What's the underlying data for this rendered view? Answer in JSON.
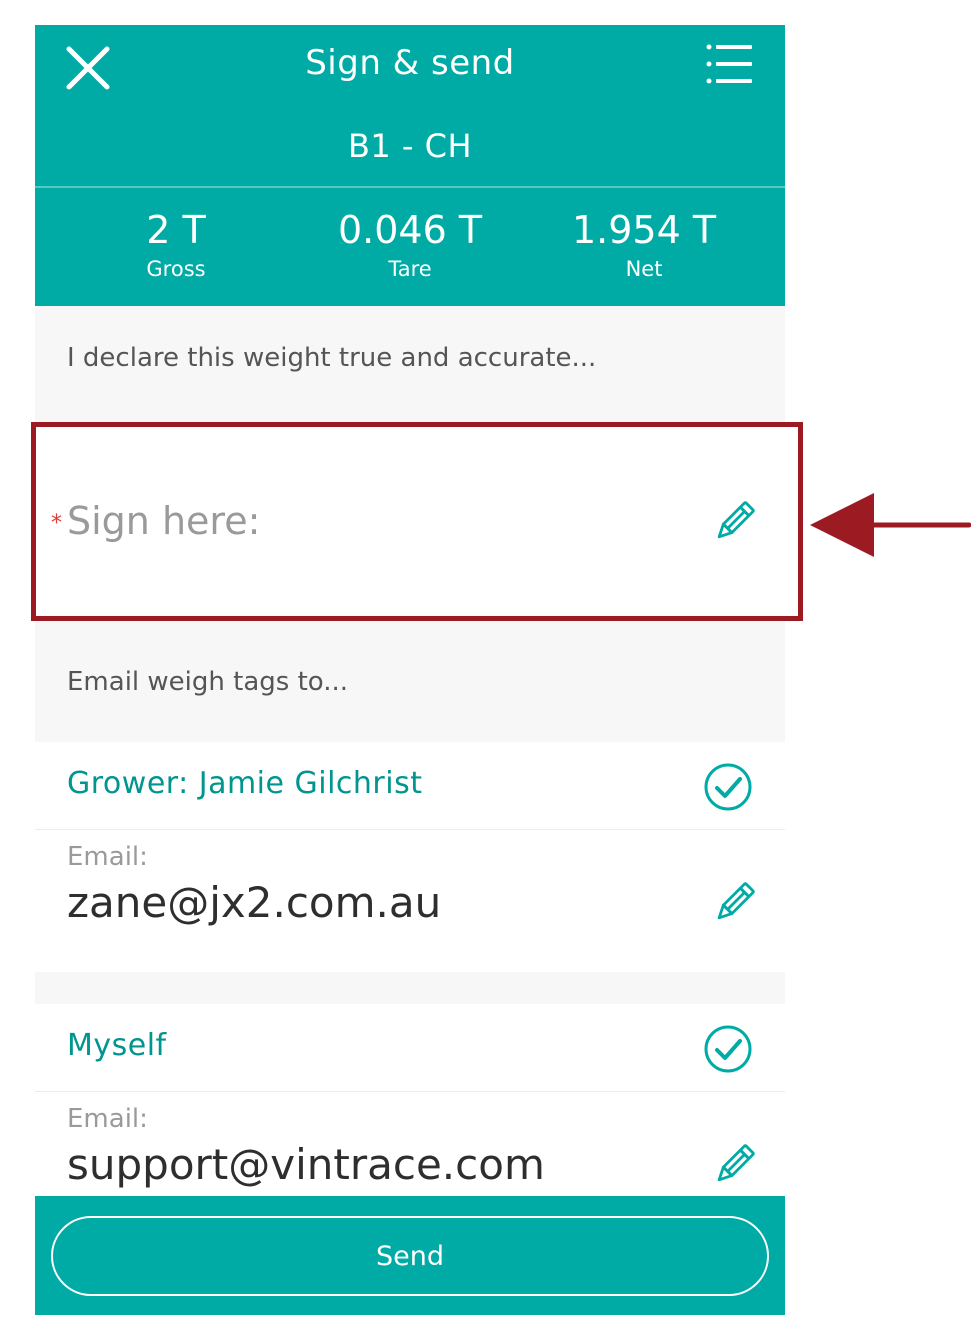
{
  "header": {
    "title": "Sign & send",
    "subtitle": "B1 - CH",
    "stats": [
      {
        "value": "2 T",
        "label": "Gross"
      },
      {
        "value": "0.046 T",
        "label": "Tare"
      },
      {
        "value": "1.954 T",
        "label": "Net"
      }
    ]
  },
  "declaration": "I declare this weight true and accurate...",
  "signature": {
    "required_marker": "*",
    "label": "Sign here:"
  },
  "email_section_heading": "Email weigh tags to...",
  "recipients": [
    {
      "name": "Grower: Jamie Gilchrist",
      "email_label": "Email:",
      "email": "zane@jx2.com.au",
      "checked": true
    },
    {
      "name": "Myself",
      "email_label": "Email:",
      "email": "support@vintrace.com",
      "checked": true
    }
  ],
  "footer": {
    "send_label": "Send"
  },
  "colors": {
    "accent": "#00aba5",
    "highlight": "#9c1a22",
    "required": "#e53935"
  },
  "icons": {
    "close": "close-icon",
    "menu": "list-menu-icon",
    "edit": "pencil-icon",
    "check": "check-circle-icon",
    "annotation": "left-arrow-icon"
  }
}
